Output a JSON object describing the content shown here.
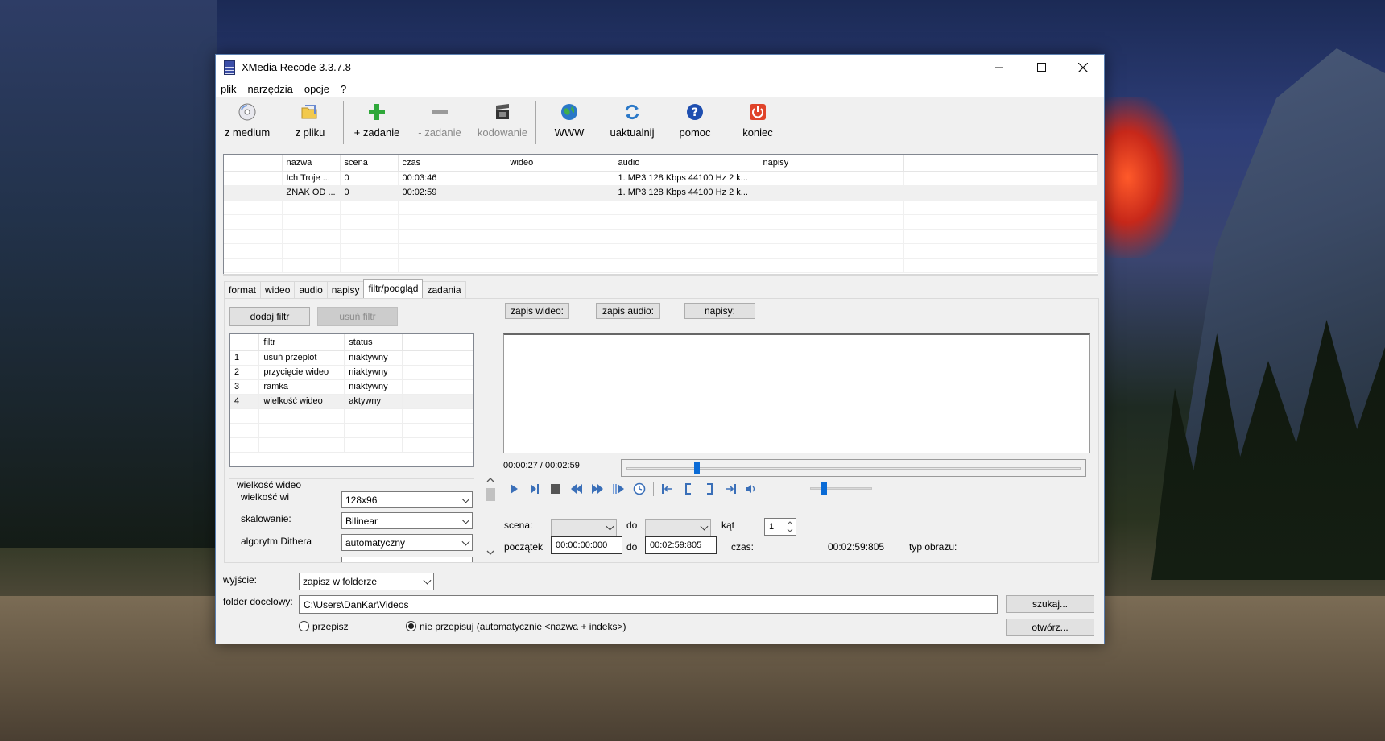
{
  "window": {
    "title": "XMedia Recode 3.3.7.8"
  },
  "menu": [
    "plik",
    "narzędzia",
    "opcje",
    "?"
  ],
  "toolbar": {
    "from_media": "z medium",
    "from_file": "z pliku",
    "add_job": "+ zadanie",
    "remove_job": "- zadanie",
    "encode": "kodowanie",
    "www": "WWW",
    "update": "uaktualnij",
    "help": "pomoc",
    "exit": "koniec"
  },
  "jobs": {
    "columns": [
      "nazwa",
      "scena",
      "czas",
      "wideo",
      "audio",
      "napisy"
    ],
    "rows": [
      {
        "nazwa": "Ich Troje ...",
        "scena": "0",
        "czas": "00:03:46",
        "wideo": "",
        "audio": "1. MP3 128 Kbps 44100 Hz 2 k...",
        "napisy": ""
      },
      {
        "nazwa": "ZNAK OD ...",
        "scena": "0",
        "czas": "00:02:59",
        "wideo": "",
        "audio": "1. MP3 128 Kbps 44100 Hz 2 k...",
        "napisy": ""
      }
    ]
  },
  "tabs": [
    "format",
    "wideo",
    "audio",
    "napisy",
    "filtr/podgląd",
    "zadania"
  ],
  "filters": {
    "add_label": "dodaj filtr",
    "remove_label": "usuń filtr",
    "columns": [
      "filtr",
      "status"
    ],
    "rows": [
      {
        "n": "1",
        "filtr": "usuń przeplot",
        "status": "niaktywny"
      },
      {
        "n": "2",
        "filtr": "przycięcie wideo",
        "status": "niaktywny"
      },
      {
        "n": "3",
        "filtr": "ramka",
        "status": "niaktywny"
      },
      {
        "n": "4",
        "filtr": "wielkość wideo",
        "status": "aktywny"
      }
    ]
  },
  "video_size": {
    "group_title": "wielkość wideo",
    "size_label": "wielkość wideo:",
    "size_value": "128x96",
    "scaling_label": "skalowanie:",
    "scaling_value": "Bilinear",
    "dither_label": "algorytm Dithera",
    "dither_value": "automatyczny"
  },
  "preview": {
    "save_video": "zapis wideo:",
    "save_audio": "zapis audio:",
    "subtitles": "napisy:",
    "time": "00:00:27 / 00:02:59",
    "position": 0.151,
    "volume": 0.2,
    "scene_label": "scena:",
    "to_label": "do",
    "angle_label": "kąt",
    "angle_value": "1",
    "start_label": "początek",
    "start_value": "00:00:00:000",
    "end_value": "00:02:59:805",
    "duration_label": "czas:",
    "duration_value": "00:02:59:805",
    "picture_type_label": "typ obrazu:"
  },
  "output": {
    "label": "wyjście:",
    "mode": "zapisz w folderze",
    "folder_label": "folder docelowy:",
    "folder_value": "C:\\Users\\DanKar\\Videos",
    "browse": "szukaj...",
    "open": "otwórz...",
    "overwrite": "przepisz",
    "no_overwrite": "nie przepisuj (automatycznie <nazwa + indeks>)"
  }
}
